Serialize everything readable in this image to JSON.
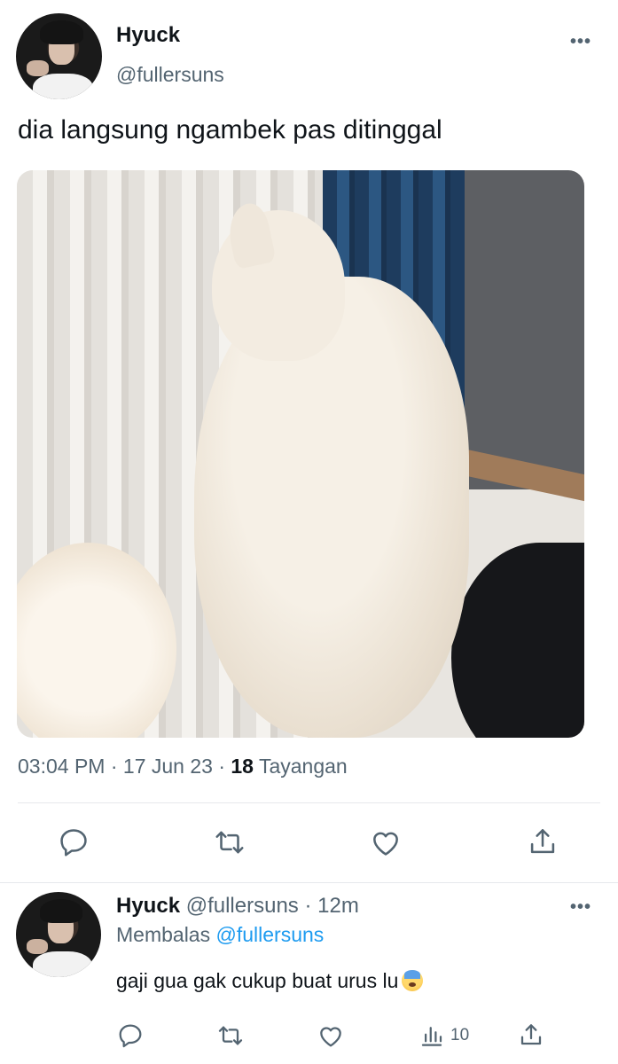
{
  "tweet": {
    "author": {
      "display_name": "Hyuck",
      "handle": "@fullersuns",
      "avatar_icon": "profile-photo"
    },
    "more_label": "•••",
    "text": "dia langsung ngambek pas ditinggal",
    "meta": {
      "time": "03:04 PM",
      "separator": "·",
      "date": "17 Jun 23",
      "views_count": "18",
      "views_label": "Tayangan"
    },
    "actions": [
      {
        "name": "reply",
        "icon": "reply-icon"
      },
      {
        "name": "retweet",
        "icon": "retweet-icon"
      },
      {
        "name": "like",
        "icon": "heart-icon"
      },
      {
        "name": "share",
        "icon": "share-icon"
      }
    ]
  },
  "reply": {
    "author": {
      "display_name": "Hyuck",
      "handle": "@fullersuns",
      "separator": "·",
      "time_ago": "12m"
    },
    "more_label": "•••",
    "replying_prefix": "Membalas",
    "replying_to": "@fullersuns",
    "text": "gaji gua gak cukup buat urus lu",
    "emoji": "anxious-face-with-sweat",
    "actions": {
      "reply_icon": "reply-icon",
      "retweet_icon": "retweet-icon",
      "like_icon": "heart-icon",
      "views_icon": "analytics-icon",
      "views_count": "10",
      "share_icon": "share-icon"
    }
  },
  "colors": {
    "text_primary": "#0f1419",
    "text_secondary": "#536471",
    "link": "#1d9bf0",
    "divider": "#e6e9ec"
  }
}
